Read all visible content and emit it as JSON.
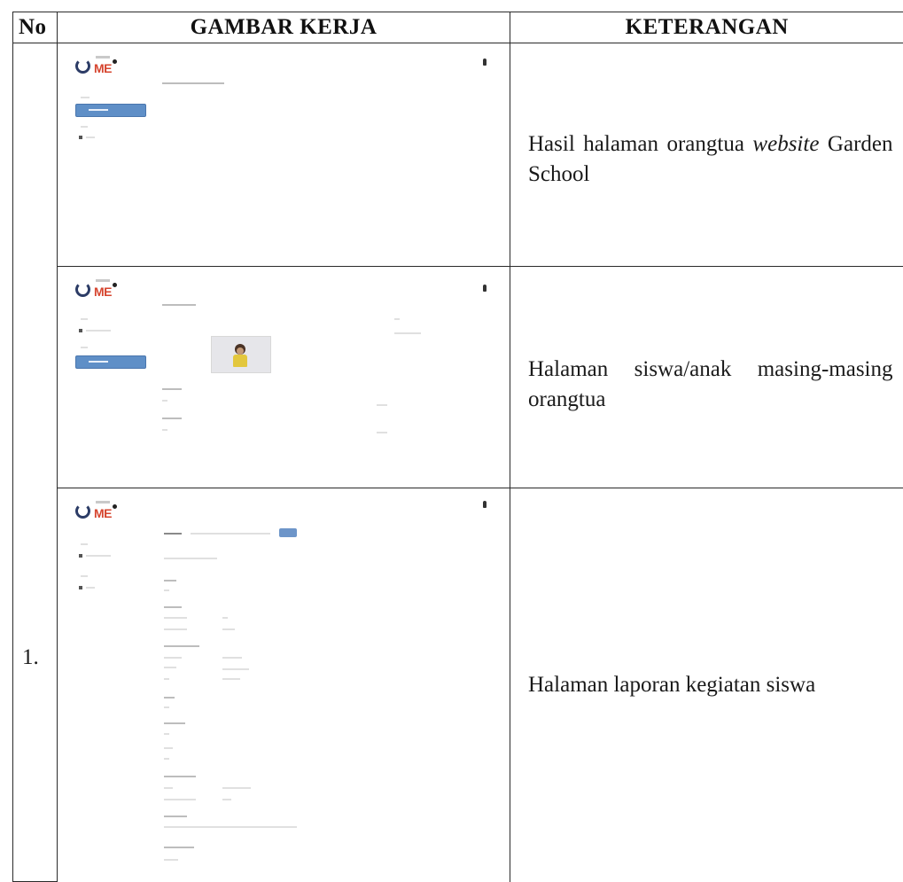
{
  "header": {
    "no": "No",
    "gambar": "GAMBAR KERJA",
    "keterangan": "KETERANGAN"
  },
  "row_number": "1.",
  "rows": [
    {
      "image_desc": "parent-page-screenshot",
      "ket_prefix": "Hasil  halaman orangtua ",
      "ket_italic": "website",
      "ket_suffix": " Garden School"
    },
    {
      "image_desc": "student-page-screenshot",
      "ket": "Halaman  siswa/anak  masing-masing orangtua"
    },
    {
      "image_desc": "activity-report-screenshot",
      "ket": "Halaman laporan kegiatan siswa"
    }
  ],
  "logo_text": "ME",
  "colors": {
    "border": "#2a2a2a",
    "nav_active": "#5f8fc7",
    "logo_red": "#d6452f",
    "logo_navy": "#2c3c66"
  }
}
